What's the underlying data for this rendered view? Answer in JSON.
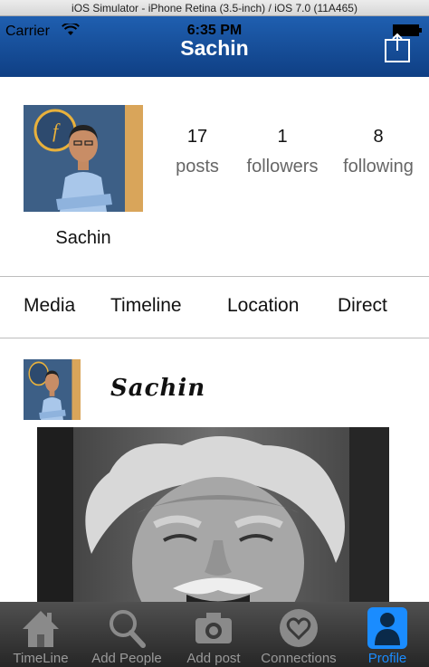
{
  "simulator": {
    "title": "iOS Simulator - iPhone Retina (3.5-inch) / iOS 7.0 (11A465)"
  },
  "status_bar": {
    "carrier": "Carrier",
    "time": "6:35 PM"
  },
  "nav": {
    "title": "Sachin"
  },
  "profile": {
    "name": "Sachin",
    "stats": [
      {
        "value": "17",
        "label": "posts"
      },
      {
        "value": "1",
        "label": "followers"
      },
      {
        "value": "8",
        "label": "following"
      }
    ]
  },
  "segments": [
    "Media",
    "Timeline",
    "Location",
    "Direct"
  ],
  "post": {
    "author": "Sachin"
  },
  "tabbar": {
    "items": [
      {
        "label": "TimeLine",
        "icon": "home-icon"
      },
      {
        "label": "Add People",
        "icon": "search-icon"
      },
      {
        "label": "Add post",
        "icon": "camera-icon"
      },
      {
        "label": "Connections",
        "icon": "heart-icon"
      },
      {
        "label": "Profile",
        "icon": "person-icon"
      }
    ],
    "active_index": 4
  },
  "colors": {
    "nav_bar": "#1a4f9c",
    "tab_active": "#1a8cff",
    "tab_inactive": "#9a9a9a"
  }
}
